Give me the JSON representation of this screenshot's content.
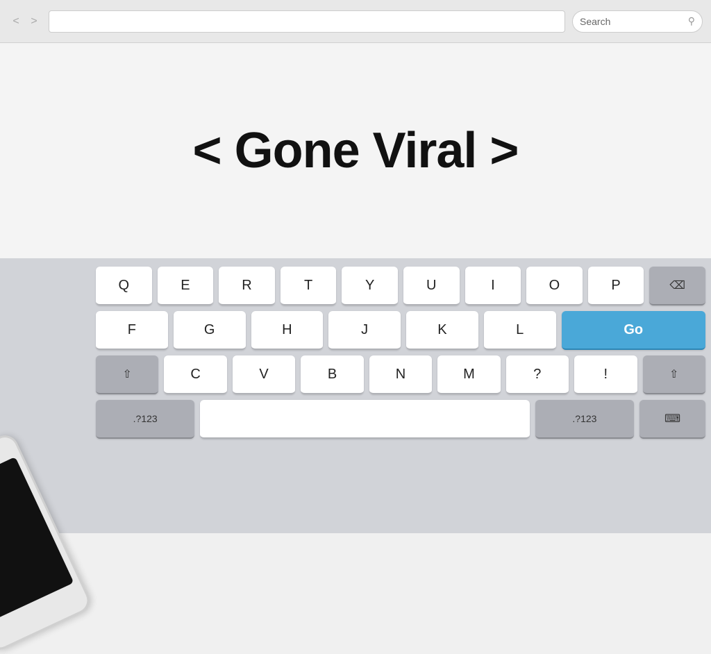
{
  "browser": {
    "nav_back": "<",
    "nav_forward": ">",
    "search_placeholder": "Search",
    "search_icon": "🔍"
  },
  "headline": {
    "text": "< Gone Viral >"
  },
  "keyboard": {
    "row1": [
      "Q",
      "E",
      "R",
      "T",
      "Y",
      "U",
      "I",
      "O",
      "P"
    ],
    "row2": [
      "F",
      "G",
      "H",
      "J",
      "K",
      "L"
    ],
    "row3": [
      "C",
      "V",
      "B",
      "N",
      "M",
      "?",
      "!"
    ],
    "go_label": "Go",
    "num_label": ".?123",
    "delete_symbol": "⌫",
    "shift_symbol": "⇧",
    "kbd_symbol": "⌨"
  },
  "phone": {
    "visible": true
  }
}
